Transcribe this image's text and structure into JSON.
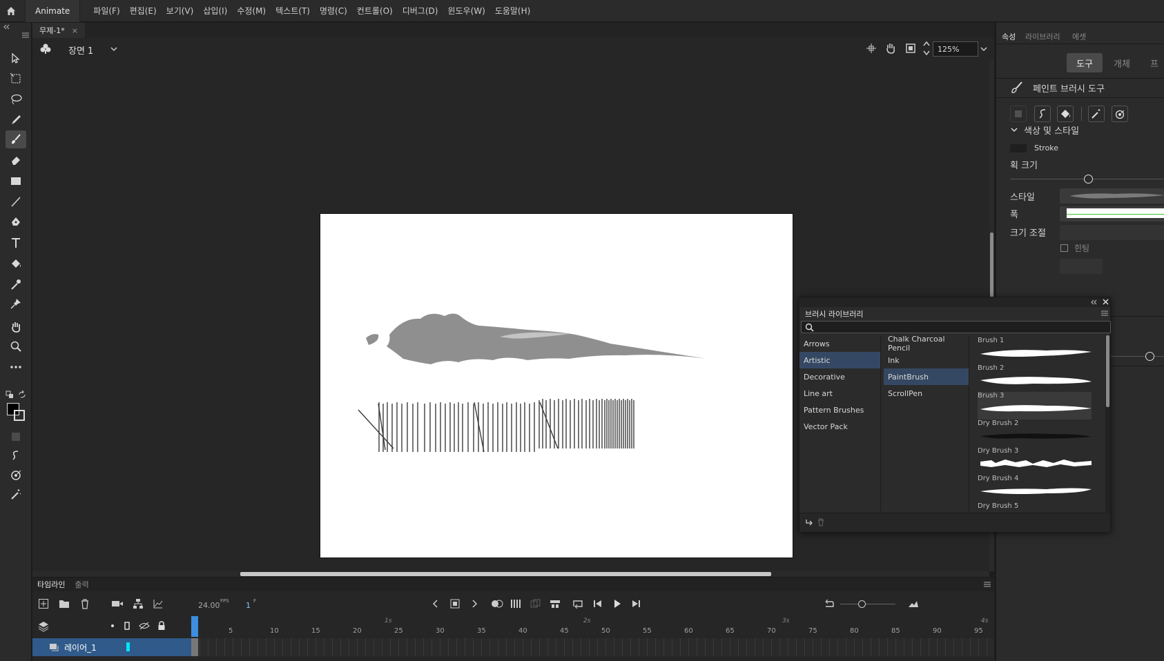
{
  "app": {
    "name": "Animate"
  },
  "menu": [
    "파일(F)",
    "편집(E)",
    "보기(V)",
    "삽입(I)",
    "수정(M)",
    "텍스트(T)",
    "명령(C)",
    "컨트롤(O)",
    "디버그(D)",
    "윈도우(W)",
    "도움말(H)"
  ],
  "document": {
    "tab_title": "무제-1*",
    "scene": "장면 1",
    "zoom": "125%"
  },
  "timeline": {
    "tabs": [
      "타임라인",
      "출력"
    ],
    "fps": "24.00",
    "fps_unit": "FPS",
    "frame": "1",
    "frame_unit": "F",
    "frame_labels": [
      "5",
      "10",
      "15",
      "20",
      "25",
      "30",
      "35",
      "40",
      "45",
      "50",
      "55",
      "60",
      "65",
      "70",
      "75",
      "80",
      "85",
      "90",
      "95"
    ],
    "second_labels": [
      "1s",
      "2s",
      "3s",
      "4s"
    ],
    "layer_name": "레이어_1"
  },
  "properties": {
    "tabs": [
      "속성",
      "라이브러리",
      "에셋"
    ],
    "mode_tabs": [
      "도구",
      "개체",
      "프"
    ],
    "tool_name": "페인트 브러시 도구",
    "section_color_style": "색상 및 스타일",
    "stroke_label": "Stroke",
    "stroke_size_label": "획 크기",
    "style_label": "스타일",
    "width_label": "폭",
    "scale_label": "크기 조절",
    "hinting_label": "힌팅",
    "stroke_color": "#1f1f1f"
  },
  "brush_library": {
    "title": "브러시 라이브러리",
    "categories": [
      "Arrows",
      "Artistic",
      "Decorative",
      "Line art",
      "Pattern Brushes",
      "Vector Pack"
    ],
    "selected_category": "Artistic",
    "subcategories": [
      "Chalk Charcoal Pencil",
      "Ink",
      "PaintBrush",
      "ScrollPen"
    ],
    "selected_subcategory": "PaintBrush",
    "brushes": [
      "Brush 1",
      "Brush 2",
      "Brush 3",
      "Dry Brush 2",
      "Dry Brush 3",
      "Dry Brush 4",
      "Dry Brush 5"
    ]
  },
  "colors": {
    "accent": "#2f5a8a",
    "selection": "#354863",
    "playhead": "#3d8ee0",
    "layer_swatch": "#00e5ff"
  }
}
